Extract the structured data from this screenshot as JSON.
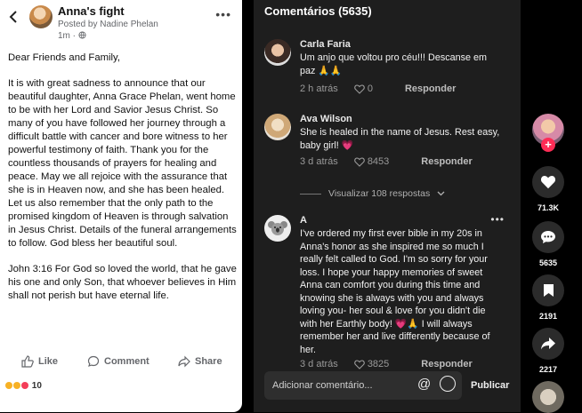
{
  "post": {
    "back_icon": "chevron-left-icon",
    "title": "Anna's fight",
    "posted_by": "Posted by Nadine Phelan",
    "age": "1m ·",
    "more": "•••",
    "paragraphs": [
      "Dear Friends and Family,",
      "It is with great sadness to announce that our beautiful daughter, Anna Grace Phelan, went home to be with her Lord and Savior Jesus Christ. So many of you have followed her journey through a difficult battle with cancer and bore witness to her powerful testimony of faith. Thank you for the countless thousands of prayers for healing and peace. May we all rejoice with the assurance that she is in Heaven now, and she has been healed. Let us also remember that the only path to the promised kingdom of Heaven is through salvation in Jesus Christ. Details of the funeral arrangements to follow. God bless her beautiful soul.",
      "John 3:16 For God so loved the world, that he gave his one and only Son, that whoever believes in Him shall not perish but have eternal life."
    ],
    "actions": {
      "like": "Like",
      "comment": "Comment",
      "share": "Share"
    },
    "reaction_count": "10"
  },
  "comments_panel": {
    "header": "Comentários (5635)",
    "comments": [
      {
        "name": "Carla Faria",
        "text": "Um anjo que voltou pro céu!!! Descanse em paz 🙏🙏",
        "time": "2 h atrás",
        "likes": "0",
        "reply": "Responder"
      },
      {
        "name": "Ava Wilson",
        "text": "She is healed in the name of Jesus. Rest easy, baby girl! 💗",
        "time": "3 d atrás",
        "likes": "8453",
        "reply": "Responder"
      },
      {
        "name": "A",
        "text": "I've ordered my first ever bible in my 20s in Anna's honor as she inspired me so much I really felt called to God. I'm so sorry for your loss. I hope your happy memories of sweet Anna can comfort you during this time and knowing she is always with you and always loving you- her soul & love for you didn't die with her Earthly body! 💗🙏 I will always remember her and live differently because of her.",
        "time": "3 d atrás",
        "likes": "3825",
        "reply": "Responder"
      }
    ],
    "view_replies": "Visualizar 108 respostas",
    "input_placeholder": "Adicionar comentário...",
    "post_button": "Publicar"
  },
  "rail": {
    "likes": "71.3K",
    "comments": "5635",
    "saves": "2191",
    "shares": "2217"
  },
  "colors": {
    "accent": "#fe2c55",
    "fb_text": "#111111",
    "panel": "#1e1e1e"
  }
}
